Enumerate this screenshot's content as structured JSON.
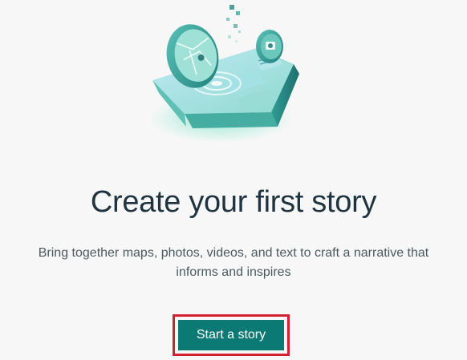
{
  "empty_state": {
    "title": "Create your first story",
    "description_line1": "Bring together maps, photos, videos, and text to craft a narrative that",
    "description_line2": "informs and inspires",
    "illustration_icon": "story-illustration-icon"
  },
  "actions": {
    "start_story_label": "Start a story"
  },
  "colors": {
    "background": "#f7f7f7",
    "title_text": "#1f3440",
    "body_text": "#4b5a5f",
    "button_background": "#0b7a74",
    "button_text": "#ffffff",
    "highlight_border": "#d32030",
    "illustration_teal": "#2f9c93"
  }
}
